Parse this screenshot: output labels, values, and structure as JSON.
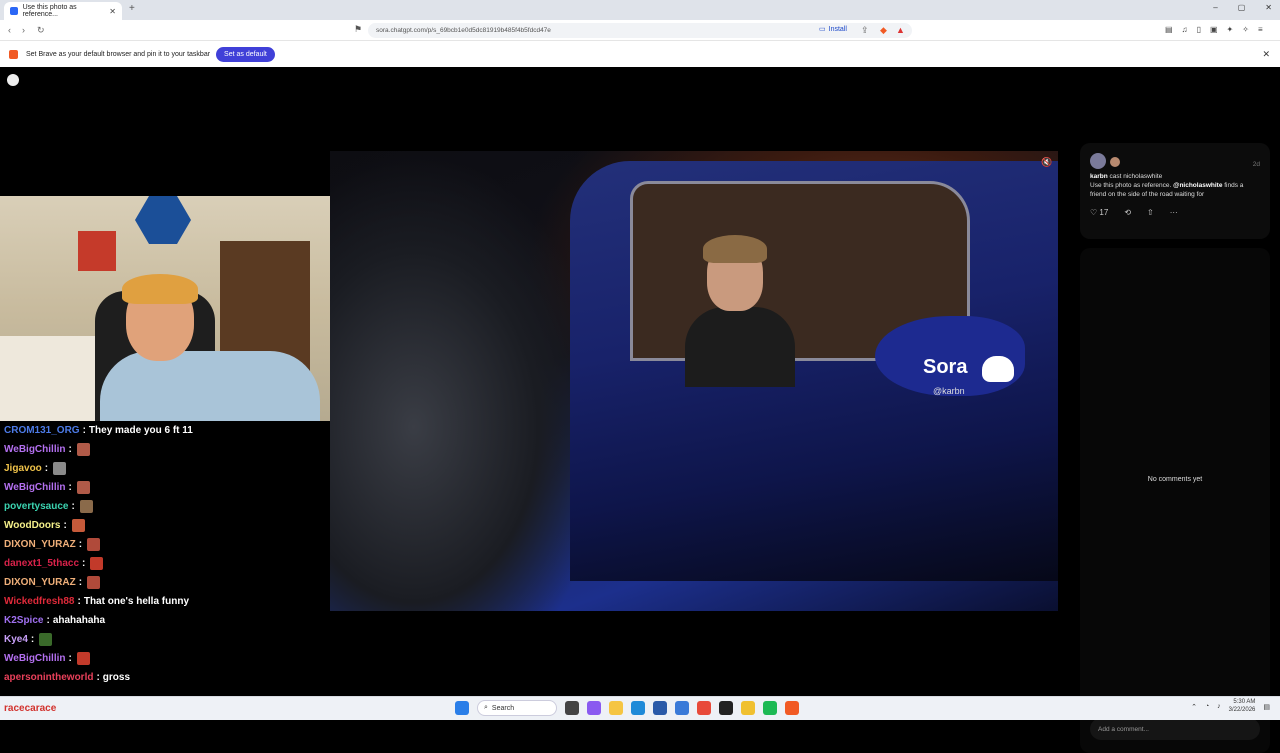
{
  "browser": {
    "tab_title": "Use this photo as reference...",
    "url": "sora.chatgpt.com/p/s_69bcb1e0d5dc81919b485f4b5fdcd47e",
    "install_label": "Install",
    "infobar_text": "Set Brave as your default browser and pin it to your taskbar",
    "set_default_label": "Set as default"
  },
  "video": {
    "watermark": "Sora",
    "watermark_handle": "@karbn"
  },
  "chat": [
    {
      "user": "CROM131_ORG",
      "color": "#4d7be8",
      "msg": "They made you 6 ft 11",
      "emote": null
    },
    {
      "user": "WeBigChillin",
      "color": "#b470f0",
      "msg": "",
      "emote": "#b05a48"
    },
    {
      "user": "Jigavoo",
      "color": "#f0c34a",
      "msg": "",
      "emote": "#8a8a8a"
    },
    {
      "user": "WeBigChillin",
      "color": "#b470f0",
      "msg": "",
      "emote": "#b05a48"
    },
    {
      "user": "povertysauce",
      "color": "#3bd3b0",
      "msg": "",
      "emote": "#8a6a4a"
    },
    {
      "user": "WoodDoors",
      "color": "#f5f08a",
      "msg": "",
      "emote": "#c65a3a"
    },
    {
      "user": "DIXON_YURAZ",
      "color": "#f0b07a",
      "msg": "",
      "emote": "#b04a3a"
    },
    {
      "user": "danext1_5thacc",
      "color": "#d8224a",
      "msg": "",
      "emote": "#c23a2a"
    },
    {
      "user": "DIXON_YURAZ",
      "color": "#f0b07a",
      "msg": "",
      "emote": "#b04a3a"
    },
    {
      "user": "Wickedfresh88",
      "color": "#e02a3a",
      "msg": "That one's hella funny",
      "emote": null
    },
    {
      "user": "K2Spice",
      "color": "#a070f0",
      "msg": "ahahahaha",
      "emote": null
    },
    {
      "user": "Kye4",
      "color": "#c8a0f8",
      "msg": "",
      "emote": "#3a6a2a"
    },
    {
      "user": "WeBigChillin",
      "color": "#b470f0",
      "msg": "",
      "emote": "#c23a2a"
    },
    {
      "user": "apersonintheworld",
      "color": "#e8405a",
      "msg": "gross",
      "emote": null
    }
  ],
  "post": {
    "age": "2d",
    "author": "karbn",
    "cast_text": "cast nicholaswhite",
    "caption_start": "Use this photo as reference.",
    "mention": "@nicholaswhite",
    "caption_end": "finds a friend on the side of the road waiting for",
    "likes": "17",
    "no_comments": "No comments yet",
    "comment_placeholder": "Add a comment..."
  },
  "taskbar": {
    "user": "racecarace",
    "search_label": "Search",
    "time": "5:30 AM",
    "date": "3/22/2026"
  },
  "icons": {
    "sora_logo": "sora-logo-icon",
    "mute": "speaker-mute-icon",
    "like": "heart-icon",
    "remix": "remix-icon",
    "share": "share-icon",
    "more": "more-icon"
  }
}
